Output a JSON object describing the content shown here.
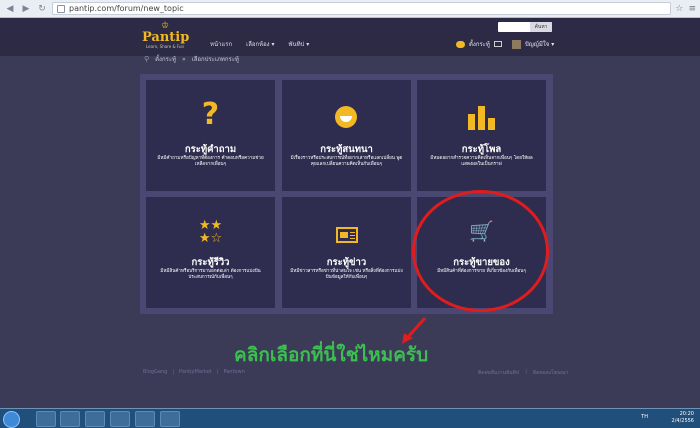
{
  "browser": {
    "url": "pantip.com/forum/new_topic"
  },
  "header": {
    "logo_text": "Pantip",
    "logo_tagline": "Learn, Share & Fun",
    "menu": [
      "หน้าแรก",
      "เลือกห้อง ▾",
      "พันทิป ▾"
    ],
    "search_button": "ค้นหา",
    "notify_text": "ตั้งกระทู้",
    "username": "ปัญญ์มีใจ ▾"
  },
  "breadcrumb": {
    "items": [
      "ตั้งกระทู้",
      "»",
      "เลือกประเภทกระทู้"
    ]
  },
  "cards": [
    {
      "title": "กระทู้คำถาม",
      "desc": "มีหมีคำถามหรือปัญหาที่ต้องการ คำตอบหรือความช่วยเหลือจากเพื่อนๆ",
      "icon": "question-icon"
    },
    {
      "title": "กระทู้สนทนา",
      "desc": "มีเรื่องราวหรือประสบการณ์ที่อยากเล่าหรือแลกเปลี่ยน พูดคุยแลกเปลี่ยนความคิดเห็นกับเพื่อนๆ",
      "icon": "smile-icon"
    },
    {
      "title": "กระทู้โพล",
      "desc": "มีหมดอยากสำรวจความคิดเห็นจากเพื่อนๆ โดยให้ผลแสดงผลในเป็นกราฟ",
      "icon": "bar-chart-icon"
    },
    {
      "title": "กระทู้รีวิว",
      "desc": "มีหมีสินค้าหรือบริการมาบอกต่อเล่า ต้องการแบ่งปันประสบการณ์กับเพื่อนๆ",
      "icon": "stars-icon"
    },
    {
      "title": "กระทู้ข่าว",
      "desc": "มีหมีข่าวสารหรือข่าวที่น่าสนใจ เช่น หรือสิ่งที่ต้องการแบ่งปันข้อมูลให้กับเพื่อนๆ",
      "icon": "newspaper-icon"
    },
    {
      "title": "กระทู้ขายของ",
      "desc": "มีหมีสินค้าที่ต้องการขาย ที่เกี่ยวข้องกับเพื่อนๆ",
      "icon": "cart-icon"
    }
  ],
  "annotation": {
    "text": "คลิกเลือกที่นี่ใช่ไหมครับ",
    "color": "#3bbf4f",
    "circle_color": "#e11c1c"
  },
  "footer": {
    "left": [
      "BlogGang",
      "|",
      "PantipMarket",
      "|",
      "Pantown"
    ],
    "right": [
      "ติดต่อทีมงานพันทิป",
      "|",
      "ติดต่อลงโฆษณา"
    ]
  },
  "taskbar": {
    "lang": "TH",
    "time": "20:20",
    "date": "2/4/2556"
  },
  "colors": {
    "accent": "#f2b924",
    "background": "#3b3a57",
    "card": "#2f2d4f"
  }
}
